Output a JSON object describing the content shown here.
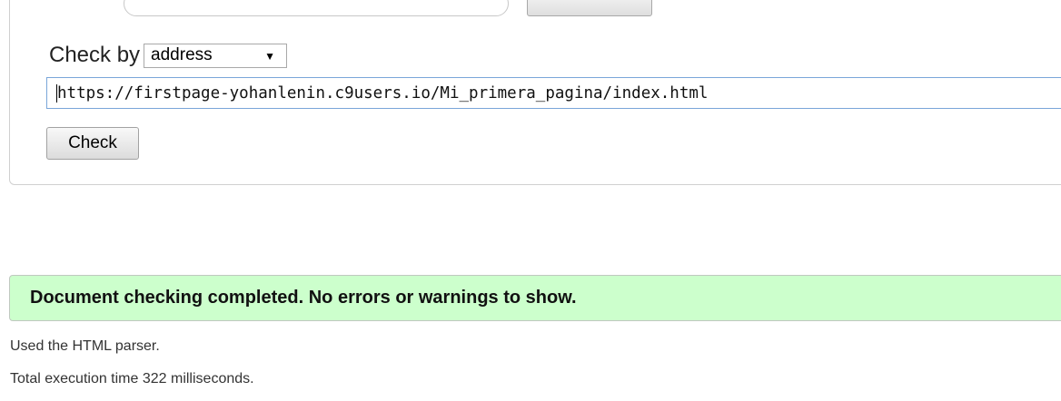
{
  "form": {
    "check_by_label": "Check by",
    "check_by_selected": "address",
    "select_arrow": "▼",
    "url_value": "https://firstpage-yohanlenin.c9users.io/Mi_primera_pagina/index.html",
    "check_button_label": "Check"
  },
  "result": {
    "message": "Document checking completed. No errors or warnings to show.",
    "parser_note": "Used the HTML parser.",
    "execution_time": "Total execution time 322 milliseconds."
  },
  "colors": {
    "success_background": "#ccffcc",
    "input_focus_border": "#7aa6d9"
  }
}
